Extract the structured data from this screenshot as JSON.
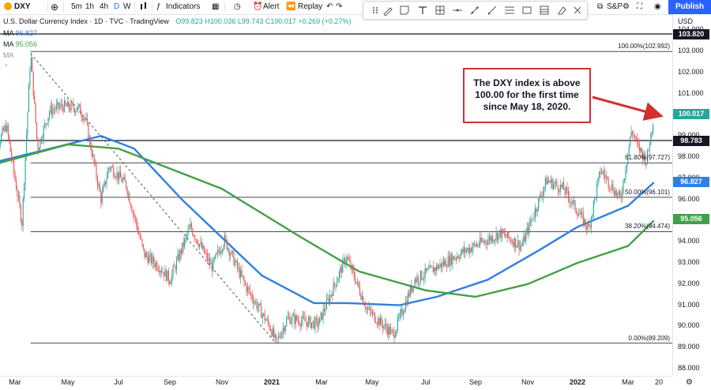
{
  "header": {
    "symbol": "DXY",
    "toolbar_items": [
      "5m",
      "1h",
      "4h",
      "D",
      "W"
    ],
    "indicators_label": "Indicators",
    "alert_label": "Alert",
    "replay_label": "Replay",
    "exchange": "S&P",
    "publish_label": "Publish",
    "currency": "USD"
  },
  "legend": {
    "title": "U.S. Dollar Currency Index · 1D · TVC · TradingView",
    "ohlc": "O99.823 H100.036 L99.743 C100.017 +0.269 (+0.27%)",
    "ma1": {
      "label": "MA",
      "value": "96.827"
    },
    "ma2": {
      "label": "MA",
      "value": "95.056"
    },
    "ma3": {
      "label": "MA",
      "value": ""
    }
  },
  "colors": {
    "up": "#26a69a",
    "down": "#ef5350",
    "ma_blue": "#2f80e0",
    "ma_green": "#43a047",
    "annotation": "#d32f2f"
  },
  "annotation": {
    "text": "The DXY index is above 100.00 for the first time since May 18, 2020."
  },
  "chart_data": {
    "type": "candlestick",
    "title": "U.S. Dollar Currency Index",
    "y_ticks": [
      88.0,
      89.0,
      90.0,
      91.0,
      92.0,
      93.0,
      94.0,
      95.0,
      96.0,
      97.0,
      98.0,
      99.0,
      100.0,
      101.0,
      102.0,
      103.0,
      104.0
    ],
    "x_ticks": [
      "Mar",
      "May",
      "Jul",
      "Sep",
      "Nov",
      "2021",
      "Mar",
      "May",
      "Jul",
      "Sep",
      "Nov",
      "2022",
      "Mar",
      "20"
    ],
    "price_path": [
      [
        "2020-02-01",
        97.8
      ],
      [
        "2020-02-20",
        99.5
      ],
      [
        "2020-03-09",
        94.9
      ],
      [
        "2020-03-19",
        102.9
      ],
      [
        "2020-03-27",
        98.4
      ],
      [
        "2020-04-10",
        100.2
      ],
      [
        "2020-04-24",
        100.4
      ],
      [
        "2020-05-14",
        100.3
      ],
      [
        "2020-05-22",
        99.8
      ],
      [
        "2020-06-10",
        96.0
      ],
      [
        "2020-06-20",
        97.6
      ],
      [
        "2020-07-10",
        96.7
      ],
      [
        "2020-08-01",
        93.4
      ],
      [
        "2020-08-20",
        92.8
      ],
      [
        "2020-09-01",
        92.2
      ],
      [
        "2020-09-25",
        94.7
      ],
      [
        "2020-10-20",
        92.8
      ],
      [
        "2020-11-04",
        94.1
      ],
      [
        "2020-11-30",
        91.9
      ],
      [
        "2020-12-31",
        89.9
      ],
      [
        "2021-01-06",
        89.2
      ],
      [
        "2021-01-20",
        90.4
      ],
      [
        "2021-02-25",
        90.1
      ],
      [
        "2021-03-15",
        91.8
      ],
      [
        "2021-03-31",
        93.3
      ],
      [
        "2021-04-25",
        90.8
      ],
      [
        "2021-05-25",
        89.6
      ],
      [
        "2021-06-18",
        92.2
      ],
      [
        "2021-07-15",
        92.8
      ],
      [
        "2021-08-20",
        93.6
      ],
      [
        "2021-09-30",
        94.4
      ],
      [
        "2021-10-25",
        93.8
      ],
      [
        "2021-11-24",
        96.9
      ],
      [
        "2021-12-15",
        96.5
      ],
      [
        "2022-01-14",
        94.6
      ],
      [
        "2022-01-28",
        97.4
      ],
      [
        "2022-02-20",
        96.0
      ],
      [
        "2022-03-07",
        99.3
      ],
      [
        "2022-03-15",
        98.6
      ],
      [
        "2022-03-31",
        97.8
      ],
      [
        "2022-04-12",
        100.0
      ]
    ],
    "moving_averages": [
      {
        "name": "MA 96.827",
        "color": "#2f80e0",
        "points": [
          [
            "2020-02-01",
            97.7
          ],
          [
            "2020-04-01",
            98.3
          ],
          [
            "2020-06-10",
            99.0
          ],
          [
            "2020-07-20",
            98.4
          ],
          [
            "2020-09-15",
            96.0
          ],
          [
            "2020-12-20",
            92.4
          ],
          [
            "2021-02-20",
            91.1
          ],
          [
            "2021-04-01",
            91.1
          ],
          [
            "2021-06-01",
            91.0
          ],
          [
            "2021-07-15",
            91.4
          ],
          [
            "2021-09-15",
            92.2
          ],
          [
            "2021-11-15",
            93.6
          ],
          [
            "2022-01-01",
            94.7
          ],
          [
            "2022-03-01",
            95.7
          ],
          [
            "2022-04-12",
            96.8
          ]
        ]
      },
      {
        "name": "MA 95.056",
        "color": "#43a047",
        "points": [
          [
            "2020-02-01",
            97.6
          ],
          [
            "2020-05-01",
            98.6
          ],
          [
            "2020-07-01",
            98.4
          ],
          [
            "2020-11-01",
            96.5
          ],
          [
            "2021-02-01",
            94.3
          ],
          [
            "2021-04-15",
            92.6
          ],
          [
            "2021-07-01",
            91.7
          ],
          [
            "2021-09-01",
            91.4
          ],
          [
            "2021-11-01",
            92.0
          ],
          [
            "2022-01-01",
            93.0
          ],
          [
            "2022-03-01",
            93.8
          ],
          [
            "2022-04-12",
            95.0
          ]
        ]
      }
    ],
    "horizontal_lines": [
      {
        "label": "103.820",
        "value": 103.82,
        "color": "#131722"
      },
      {
        "label": "98.783",
        "value": 98.783,
        "color": "#131722"
      }
    ],
    "fibonacci": [
      {
        "label": "100.00%(102.992)",
        "value": 102.992
      },
      {
        "label": "61.80%(97.727)",
        "value": 97.727
      },
      {
        "label": "50.00%(96.101)",
        "value": 96.101
      },
      {
        "label": "38.20%(94.474)",
        "value": 94.474
      },
      {
        "label": "0.00%(89.209)",
        "value": 89.209
      }
    ],
    "price_tags": [
      {
        "label": "103.820",
        "value": 103.82,
        "color": "#131722"
      },
      {
        "label": "100.017",
        "value": 100.017,
        "color": "#26a69a"
      },
      {
        "label": "98.783",
        "value": 98.783,
        "color": "#131722"
      },
      {
        "label": "96.827",
        "value": 96.827,
        "color": "#2f80e0"
      },
      {
        "label": "95.056",
        "value": 95.056,
        "color": "#43a047"
      }
    ],
    "trendline": [
      [
        "2020-03-19",
        102.9
      ],
      [
        "2021-01-06",
        89.2
      ]
    ],
    "last": {
      "date": "2022-04-12",
      "open": 99.823,
      "high": 100.036,
      "low": 99.743,
      "close": 100.017
    },
    "ylim": [
      88.0,
      104.4
    ]
  }
}
